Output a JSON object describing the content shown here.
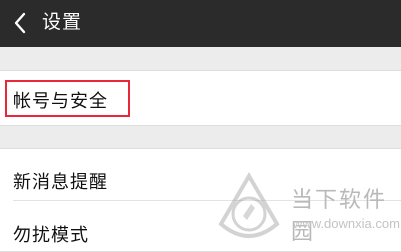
{
  "header": {
    "title": "设置",
    "back_icon": "chevron-left-icon"
  },
  "settings": {
    "account_security": "帐号与安全",
    "new_message_alert": "新消息提醒",
    "do_not_disturb": "勿扰模式"
  },
  "watermark": {
    "name": "当下软件园",
    "url": "www.downxia.com"
  },
  "colors": {
    "header_bg": "#2b2b2b",
    "highlight_border": "#e8283a"
  }
}
